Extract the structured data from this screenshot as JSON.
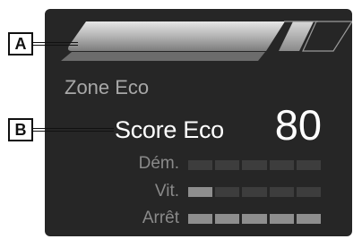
{
  "callouts": {
    "a": "A",
    "b": "B"
  },
  "display": {
    "zone_title": "Zone Eco",
    "score_label": "Score Eco",
    "score_value": "80",
    "rows": [
      {
        "label": "Dém.",
        "segments_total": 5,
        "segments_on": 0
      },
      {
        "label": "Vit.",
        "segments_total": 5,
        "segments_on": 1
      },
      {
        "label": "Arrêt",
        "segments_total": 5,
        "segments_on": 5
      }
    ],
    "gauge": {
      "zone_fill_fraction": 0.73
    }
  },
  "colors": {
    "screen_background": "#262626",
    "segment_off": "#3d3d3d",
    "segment_on": "#8e8e8e",
    "text_primary": "#ffffff",
    "text_secondary": "#a8a8a8"
  }
}
